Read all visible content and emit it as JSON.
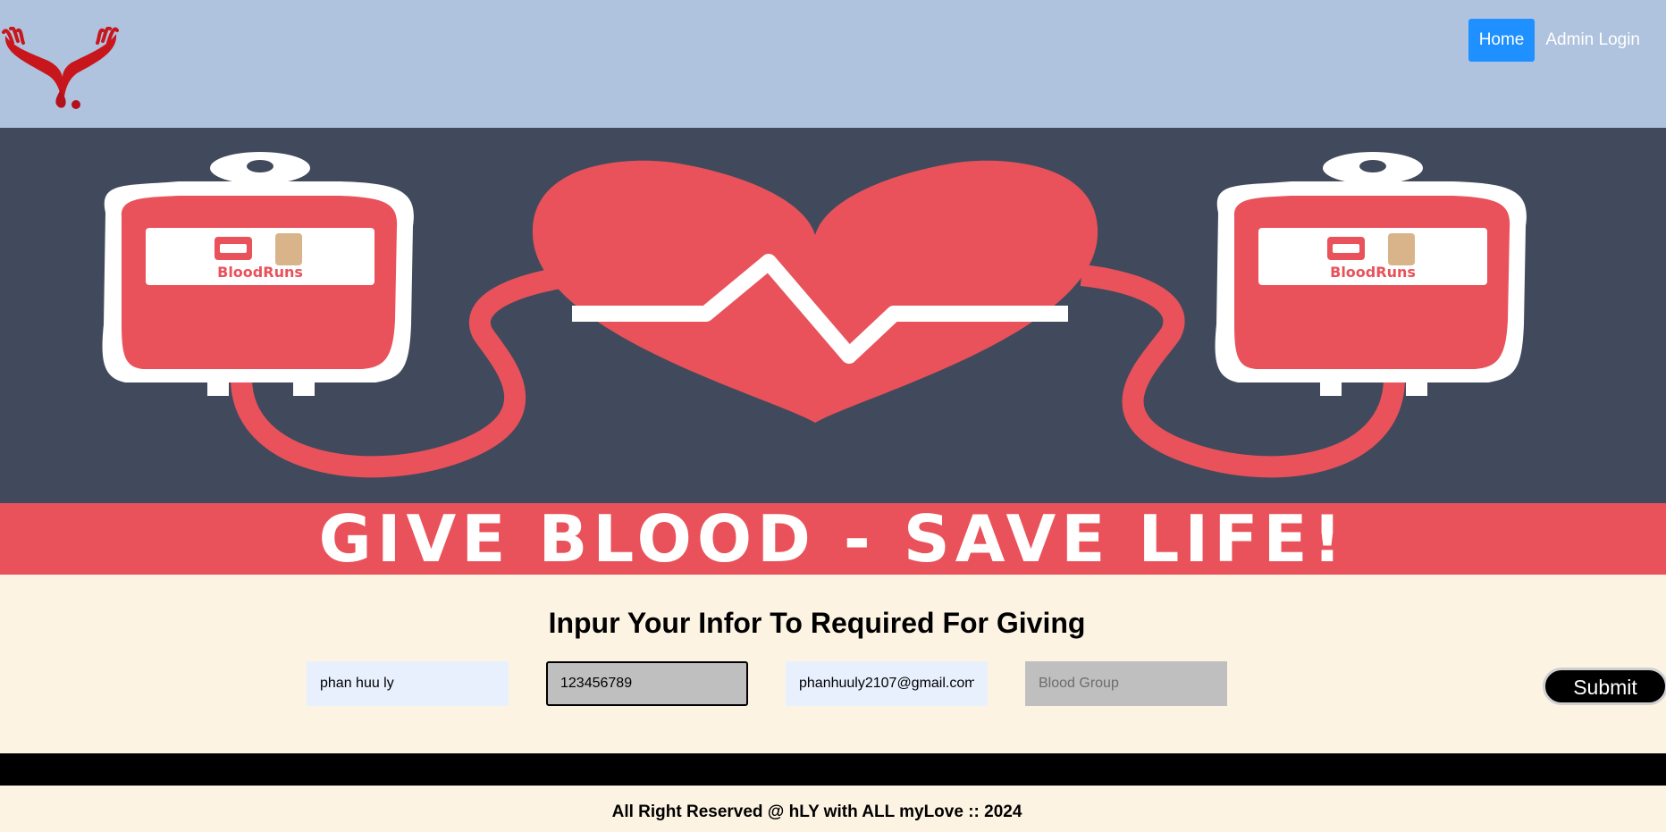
{
  "nav": {
    "home_label": "Home",
    "admin_label": "Admin Login"
  },
  "banner": {
    "headline": "GIVE BLOOD - SAVE LIFE!",
    "bag_label": "BloodRuns"
  },
  "form": {
    "title": "Inpur Your Infor To Required For Giving",
    "name_value": "phan huu ly",
    "phone_value": "123456789",
    "email_value": "phanhuuly2107@gmail.com",
    "blood_group_placeholder": "Blood Group",
    "submit_label": "Submit"
  },
  "footer": {
    "text": "All Right Reserved @ hLY with ALL myLove :: 2024"
  },
  "colors": {
    "header_bg": "#afc3de",
    "nav_active": "#1e90ff",
    "banner_bg": "#414a5c",
    "brand_red": "#e9525a",
    "page_bg": "#fdf3e3"
  },
  "icons": {
    "logo": "hands-blood-drop-logo"
  }
}
